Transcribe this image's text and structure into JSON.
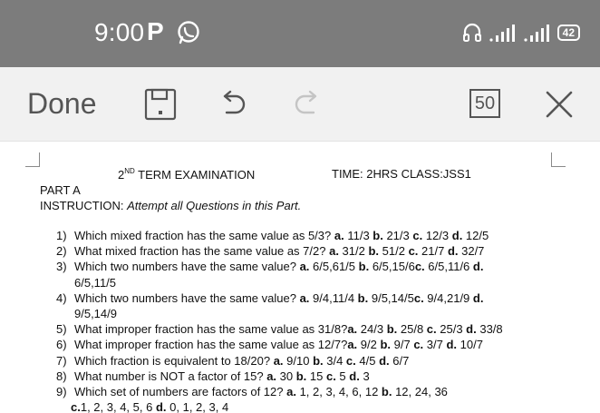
{
  "status_bar": {
    "time": "9:00",
    "p_badge": "P",
    "battery": "42"
  },
  "toolbar": {
    "done_label": "Done",
    "page_count": "50"
  },
  "document": {
    "term_prefix": "2",
    "term_sup": "ND",
    "term_rest": " TERM EXAMINATION",
    "time_class": "TIME: 2HRS CLASS:JSS1",
    "part": "PART A",
    "instruction_label": "INSTRUCTION: ",
    "instruction_text": "Attempt all Questions in this Part.",
    "questions": [
      {
        "num": "1)",
        "line": "Which mixed fraction has the same value as 5/3? <b>a.</b> 11/3 <b>b.</b> 21/3 <b>c.</b> 12/3 <b>d.</b> 12/5"
      },
      {
        "num": "2)",
        "line": "What mixed fraction has the same value as 7/2? <b>a.</b> 31/2 <b>b.</b> 51/2 <b>c.</b> 21/7 <b>d.</b> 32/7"
      },
      {
        "num": "3)",
        "line": "Which two numbers have the same value? <b>a.</b> 6/5,61/5 <b>b.</b> 6/5,15/6<b>c.</b> 6/5,11/6 <b>d.</b><br>6/5,11/5"
      },
      {
        "num": "4)",
        "line": "Which two numbers have the same value? <b>a.</b> 9/4,11/4 <b>b.</b> 9/5,14/5<b>c.</b> 9/4,21/9 <b>d.</b><br>9/5,14/9"
      },
      {
        "num": "5)",
        "line": "What improper fraction has the same value as 31/8?<b>a.</b> 24/3 <b>b.</b> 25/8 <b>c.</b> 25/3 <b>d.</b> 33/8"
      },
      {
        "num": "6)",
        "line": "What improper fraction has the same value as 12/7?<b>a.</b> 9/2 <b>b.</b> 9/7 <b>c.</b> 3/7 <b>d.</b> 10/7"
      },
      {
        "num": "7)",
        "line": "Which fraction is equivalent to 18/20? <b>a.</b> 9/10 <b>b.</b> 3/4 <b>c.</b> 4/5 <b>d.</b> 6/7"
      },
      {
        "num": "8)",
        "line": "What number is NOT a factor of 15? <b>a.</b> 30 <b>b.</b> 15 <b>c.</b> 5 <b>d.</b> 3"
      },
      {
        "num": "9)",
        "line": "Which set of numbers are factors of 12? <b>a.</b> 1, 2, 3, 4, 6, 12 <b>b.</b> 12, 24, 36<br><span style=\"margin-left:-4px\"><b>c.</b>1, 2, 3, 4, 5, 6 <b>d.</b> 0, 1, 2, 3, 4</span>"
      }
    ]
  }
}
